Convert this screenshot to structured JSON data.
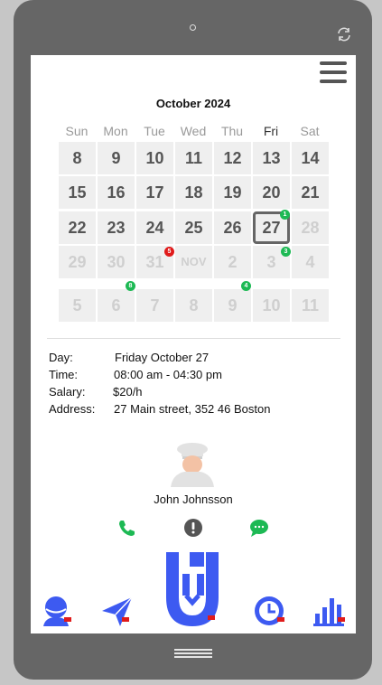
{
  "calendar": {
    "month_title": "October 2024",
    "weekdays": [
      "Sun",
      "Mon",
      "Tue",
      "Wed",
      "Thu",
      "Fri",
      "Sat"
    ],
    "today_weekday": "Fri",
    "rows": [
      [
        "8",
        "9",
        "10",
        "11",
        "12",
        "13",
        "14"
      ],
      [
        "15",
        "16",
        "17",
        "18",
        "19",
        "20",
        "21"
      ],
      [
        "22",
        "23",
        "24",
        "25",
        "26",
        "27",
        "28"
      ],
      [
        "29",
        "30",
        "31",
        "NOV",
        "2",
        "3",
        "4"
      ],
      [
        "5",
        "6",
        "7",
        "8",
        "9",
        "10",
        "11"
      ]
    ],
    "selected_day": "27",
    "badges": {
      "b1": "1",
      "b2": "3",
      "b3": "5",
      "b4": "8",
      "b5": "4"
    }
  },
  "shift": {
    "day_label": "Day:",
    "day_value": "Friday October 27",
    "time_label": "Time:",
    "time_value": "08:00 am - 04:30 pm",
    "salary_label": "Salary:",
    "salary_value": "$20/h",
    "address_label": "Address:",
    "address_value": "27 Main street, 352 46 Boston"
  },
  "contact": {
    "name": "John Johnsson"
  },
  "colors": {
    "accent_green": "#1db954",
    "alert_red": "#e01b1b",
    "nav_blue": "#3d5af1"
  },
  "icons": [
    "menu-icon",
    "chef-avatar-icon",
    "phone-icon",
    "alert-icon",
    "chat-icon",
    "profile-icon",
    "send-icon",
    "logo-icon",
    "clock-icon",
    "stats-icon"
  ]
}
